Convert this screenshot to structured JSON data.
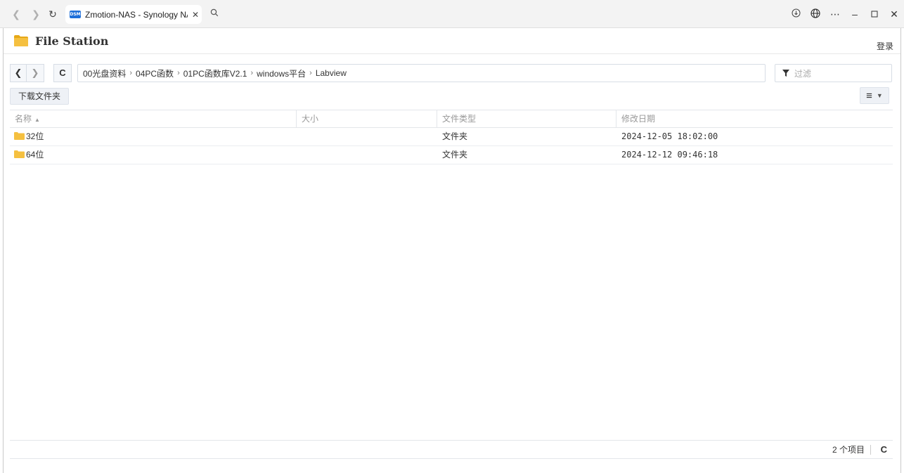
{
  "browser": {
    "tab_title": "Zmotion-NAS - Synology NAS",
    "favicon_label": "DSM",
    "close_glyph": "✕",
    "colors": {
      "favicon": "#1e6fd9"
    }
  },
  "app": {
    "title": "File Station",
    "login_label": "登录"
  },
  "path": {
    "segments": [
      "00光盘资料",
      "04PC函数",
      "01PC函数库V2.1",
      "windows平台",
      "Labview"
    ],
    "separator": "›"
  },
  "filter": {
    "placeholder": "过滤"
  },
  "toolbar": {
    "download_label": "下载文件夹"
  },
  "table": {
    "columns": [
      "名称",
      "大小",
      "文件类型",
      "修改日期"
    ],
    "sort_indicator": "▲",
    "rows": [
      {
        "name": "32位",
        "size": "",
        "type": "文件夹",
        "modified": "2024-12-05 18:02:00"
      },
      {
        "name": "64位",
        "size": "",
        "type": "文件夹",
        "modified": "2024-12-12 09:46:18"
      }
    ]
  },
  "status": {
    "count_label": "2 个项目"
  },
  "colors": {
    "folder": "#f5c040",
    "folder_dark": "#e6a817",
    "accent": "#1e6fd9"
  }
}
